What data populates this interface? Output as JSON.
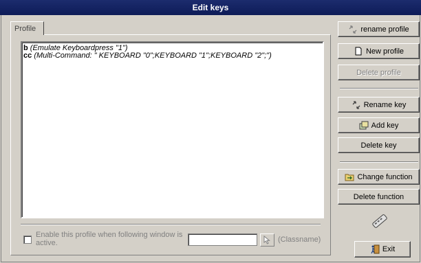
{
  "window": {
    "title": "Edit keys"
  },
  "tab": {
    "label": "Profile"
  },
  "keys": [
    {
      "name": "b",
      "description": "(Emulate Keyboardpress \"1\")"
    },
    {
      "name": "cc",
      "description": "(Multi-Command: \" KEYBOARD \"0\";KEYBOARD \"1\";KEYBOARD \"2\";\")"
    }
  ],
  "window_binding": {
    "checkbox_label": "Enable this profile when following window is active.",
    "checked": false,
    "window_value": "",
    "classname_label": "(Classname)"
  },
  "buttons": {
    "rename_profile": "rename profile",
    "new_profile": "New profile",
    "delete_profile": "Delete profile",
    "rename_key": "Rename key",
    "add_key": "Add key",
    "delete_key": "Delete key",
    "change_function": "Change function",
    "delete_function": "Delete function",
    "exit": "Exit"
  },
  "icons": {
    "rename_profile": "rename-arrows-icon",
    "new_profile": "new-document-icon",
    "rename_key": "rename-arrows-icon",
    "add_key": "add-key-icon",
    "change_function": "change-function-icon",
    "remote": "remote-control-icon",
    "exit": "exit-door-icon",
    "window_picker": "pointer-icon"
  },
  "colors": {
    "titlebar": "#0d1b57",
    "face": "#d4d0c8",
    "disabled_text": "#808080"
  }
}
